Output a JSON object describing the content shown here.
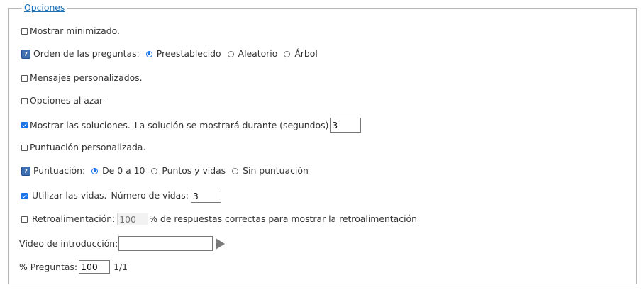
{
  "legend": "Opciones",
  "show_minimized": {
    "label": "Mostrar minimizado.",
    "checked": false
  },
  "question_order": {
    "label": "Orden de las preguntas:",
    "options": [
      "Preestablecido",
      "Aleatorio",
      "Árbol"
    ],
    "selected": "Preestablecido"
  },
  "custom_messages": {
    "label": "Mensajes personalizados.",
    "checked": false
  },
  "random_options": {
    "label": "Opciones al azar",
    "checked": false
  },
  "show_solutions": {
    "label": "Mostrar las soluciones.",
    "checked": true,
    "duration_label": "La solución se mostrará durante (segundos)",
    "duration_value": "3"
  },
  "custom_score": {
    "label": "Puntuación personalizada.",
    "checked": false
  },
  "scoring": {
    "label": "Puntuación:",
    "options": [
      "De 0 a 10",
      "Puntos y vidas",
      "Sin puntuación"
    ],
    "selected": "De 0 a 10"
  },
  "lives": {
    "label": "Utilizar las vidas.",
    "checked": true,
    "count_label": "Número de vidas:",
    "count_value": "3"
  },
  "feedback": {
    "label": "Retroalimentación:",
    "checked": false,
    "value": "100",
    "suffix": "% de respuestas correctas para mostrar la retroalimentación"
  },
  "intro_video": {
    "label": "Vídeo de introducción:",
    "value": ""
  },
  "questions_pct": {
    "label": "% Preguntas:",
    "value": "100",
    "count": "1/1"
  },
  "colors": {
    "accent": "#1a73e8",
    "legend": "#1a6fb5",
    "help_icon": "#3f6fb3"
  }
}
